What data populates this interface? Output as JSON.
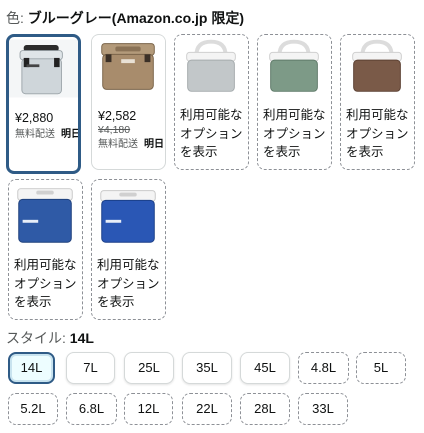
{
  "color_selector": {
    "label": "色:",
    "selected_value": "ブルーグレー(Amazon.co.jp 限定)"
  },
  "color_options": [
    {
      "image": "gray-cooler-box",
      "price": "¥2,880",
      "list_price": "",
      "shipping": "無料配送",
      "delivery": "明日",
      "not_available_lines": []
    },
    {
      "image": "tan-cooler-box",
      "price": "¥2,582",
      "list_price": "¥4,180",
      "shipping": "無料配送",
      "delivery": "明日",
      "not_available_lines": []
    },
    {
      "image": "light-gray-cooler-box",
      "price": "",
      "list_price": "",
      "shipping": "",
      "delivery": "",
      "not_available_lines": [
        "利用可能な",
        "オプション",
        "を表示"
      ]
    },
    {
      "image": "green-cooler-box",
      "price": "",
      "list_price": "",
      "shipping": "",
      "delivery": "",
      "not_available_lines": [
        "利用可能な",
        "オプション",
        "を表示"
      ]
    },
    {
      "image": "brown-cooler-box",
      "price": "",
      "list_price": "",
      "shipping": "",
      "delivery": "",
      "not_available_lines": [
        "利用可能な",
        "オプション",
        "を表示"
      ]
    },
    {
      "image": "blue-cooler-box",
      "price": "",
      "list_price": "",
      "shipping": "",
      "delivery": "",
      "not_available_lines": [
        "利用可能な",
        "オプション",
        "を表示"
      ]
    },
    {
      "image": "blue-cooler-box-alt",
      "price": "",
      "list_price": "",
      "shipping": "",
      "delivery": "",
      "not_available_lines": [
        "利用可能な",
        "オプション",
        "を表示"
      ]
    }
  ],
  "style_selector": {
    "label": "スタイル:",
    "selected_value": "14L"
  },
  "size_options": [
    {
      "label": "14L",
      "state": "selected"
    },
    {
      "label": "7L",
      "state": "available"
    },
    {
      "label": "25L",
      "state": "available"
    },
    {
      "label": "35L",
      "state": "available"
    },
    {
      "label": "45L",
      "state": "available"
    },
    {
      "label": "4.8L",
      "state": "unavailable"
    },
    {
      "label": "5L",
      "state": "unavailable"
    },
    {
      "label": "5.2L",
      "state": "unavailable"
    },
    {
      "label": "6.8L",
      "state": "unavailable"
    },
    {
      "label": "12L",
      "state": "unavailable"
    },
    {
      "label": "22L",
      "state": "unavailable"
    },
    {
      "label": "28L",
      "state": "unavailable"
    },
    {
      "label": "33L",
      "state": "unavailable"
    }
  ],
  "colors": {
    "selected_border": "#2f5b86",
    "selected_fill": "#edfdff",
    "cooler_gray": "#cfd6da",
    "cooler_tan": "#a88c6c",
    "cooler_light_gray": "#c2c7c9",
    "cooler_green": "#7d9a87",
    "cooler_brown": "#7a5a48",
    "cooler_blue": "#2f5aa6",
    "cooler_lid_white": "#f4f4f4"
  }
}
